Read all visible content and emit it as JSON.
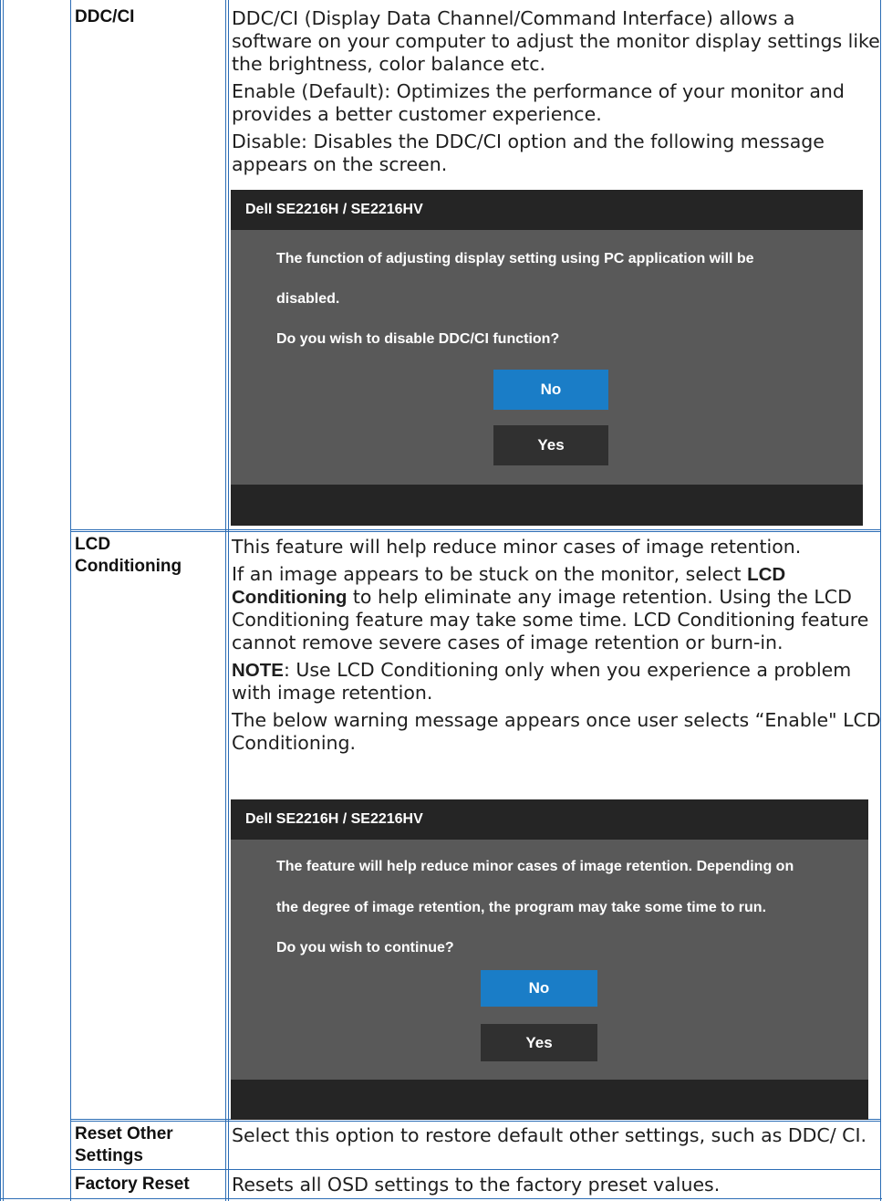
{
  "rows": {
    "ddc": {
      "term": "DDC/CI",
      "p1": "DDC/CI (Display Data Channel/Command Interface) allows a software on your computer to adjust the monitor display settings like the brightness, color balance etc.",
      "p2": "Enable (Default): Optimizes the performance of your monitor and provides a better customer experience.",
      "p3": "Disable: Disables the DDC/CI option and the following message appears on the screen."
    },
    "lcd": {
      "term_line1": "LCD",
      "term_line2": "Conditioning",
      "p1": "This feature will help reduce minor cases of image retention.",
      "p2_before": "If an image appears to be stuck on the monitor, select ",
      "p2_bold": "LCD Conditioning",
      "p2_after": " to help eliminate any image retention. Using the LCD Conditioning feature may take some time. LCD Conditioning feature cannot remove  severe cases of image retention or burn-in.",
      "note_bold": "NOTE",
      "note_text": ": Use LCD Conditioning only when you experience a problem with image retention.",
      "p4": "The below warning message appears once user selects “Enable\" LCD Conditioning."
    },
    "reset_other": {
      "term_line1": "Reset Other",
      "term_line2": "Settings",
      "desc": "Select this option to restore default other settings, such as DDC/ CI."
    },
    "factory": {
      "term": "Factory Reset",
      "desc": "Resets all OSD settings to the factory preset values."
    }
  },
  "dialog_ddc": {
    "title": "Dell SE2216H / SE2216HV",
    "line1": "The function of adjusting display setting using PC application will be",
    "line2": "disabled.",
    "line3": "Do you wish to disable DDC/CI function?",
    "no_label": "No",
    "yes_label": "Yes"
  },
  "dialog_lcd": {
    "title": "Dell SE2216H / SE2216HV",
    "line1": "The feature will help reduce minor cases of image retention. Depending on",
    "line2": "the degree of image retention, the program may take some time to run.",
    "line3": "Do you wish to continue?",
    "no_label": "No",
    "yes_label": "Yes"
  },
  "colors": {
    "border": "#2c6db5",
    "dialog_title_bg": "#252525",
    "dialog_body_bg": "#595959",
    "button_no": "#1a7dc7",
    "button_yes": "#303030"
  }
}
